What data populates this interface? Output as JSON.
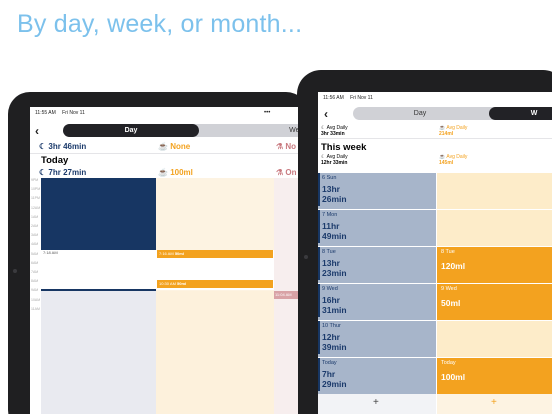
{
  "headline": "By day, week, or month...",
  "left_device": {
    "status_time": "11:55 AM",
    "status_date": "Fri Nov 11",
    "status_dots": "•••",
    "tabs": [
      "Day",
      "Week"
    ],
    "selected_tab": "Day",
    "back_glyph": "‹",
    "summary": {
      "sleep": "3hr 46min",
      "water": "None",
      "other": "No"
    },
    "today_title": "Today",
    "today_summary": {
      "sleep": "7hr 27min",
      "water": "100ml",
      "other": "On"
    },
    "wake_label": "7:18 AM",
    "water_entries": [
      {
        "time": "7:16 AM",
        "amount": "50ml"
      },
      {
        "time": "10:30 AM",
        "amount": "50ml"
      }
    ],
    "other_entry_time": "11:04 AM",
    "ticks": [
      "00PM",
      "1PM",
      "2PM",
      "3PM",
      "4PM",
      "5PM",
      "6PM",
      "7PM",
      "8PM",
      "9PM",
      "10PM",
      "11PM",
      "12AM",
      "1AM",
      "2AM",
      "3AM",
      "4AM",
      "5AM",
      "6AM",
      "7AM",
      "8AM",
      "9AM",
      "10AM",
      "11AM"
    ]
  },
  "right_device": {
    "status_time": "11:56 AM",
    "status_date": "Fri Nov 11",
    "tabs": [
      "Day",
      "W"
    ],
    "selected_tab": "W",
    "back_glyph": "‹",
    "avg_label": "Avg Daily",
    "avg_sleep": "3hr 33min",
    "avg_water": "214ml",
    "week_title": "This week",
    "week_avg_sleep": "12hr 33min",
    "week_avg_water": "145ml",
    "add_glyph": "+",
    "sleep_rows": [
      {
        "day": "6 Sun",
        "value_line1": "13hr",
        "value_line2": "26min"
      },
      {
        "day": "7 Mon",
        "value_line1": "11hr",
        "value_line2": "49min"
      },
      {
        "day": "8 Tue",
        "value_line1": "13hr",
        "value_line2": "23min"
      },
      {
        "day": "9 Wed",
        "value_line1": "16hr",
        "value_line2": "31min"
      },
      {
        "day": "10 Thur",
        "value_line1": "12hr",
        "value_line2": "39min"
      },
      {
        "day": "Today",
        "value_line1": "7hr",
        "value_line2": "29min"
      }
    ],
    "water_rows": [
      {
        "day": "",
        "value": ""
      },
      {
        "day": "",
        "value": ""
      },
      {
        "day": "8 Tue",
        "value": "120ml"
      },
      {
        "day": "9 Wed",
        "value": "50ml"
      },
      {
        "day": "",
        "value": ""
      },
      {
        "day": "Today",
        "value": "100ml"
      }
    ]
  },
  "colors": {
    "headline": "#7cc1ec",
    "navy": "#1b3a6b",
    "sleep_light": "#a9b7cb",
    "orange": "#f3a21f",
    "water_light": "#fdeccc"
  }
}
